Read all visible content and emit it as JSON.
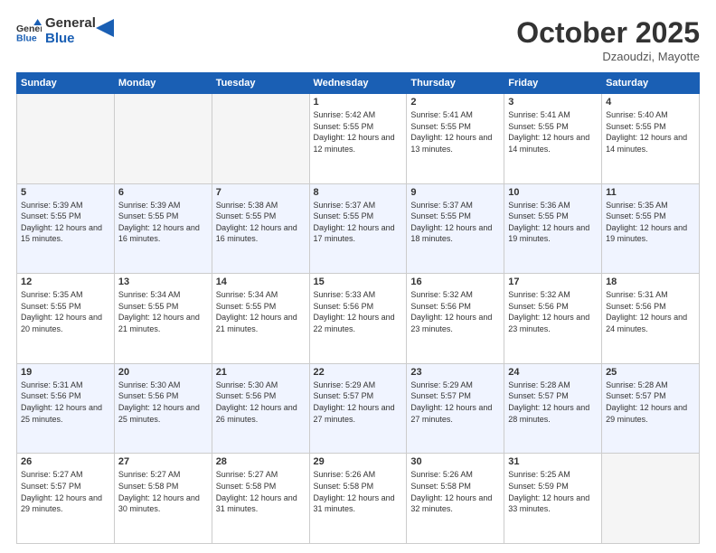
{
  "logo": {
    "line1": "General",
    "line2": "Blue"
  },
  "title": "October 2025",
  "subtitle": "Dzaoudzi, Mayotte",
  "weekdays": [
    "Sunday",
    "Monday",
    "Tuesday",
    "Wednesday",
    "Thursday",
    "Friday",
    "Saturday"
  ],
  "rows": [
    [
      {
        "day": "",
        "empty": true
      },
      {
        "day": "",
        "empty": true
      },
      {
        "day": "",
        "empty": true
      },
      {
        "day": "1",
        "sunrise": "5:42 AM",
        "sunset": "5:55 PM",
        "daylight": "12 hours and 12 minutes."
      },
      {
        "day": "2",
        "sunrise": "5:41 AM",
        "sunset": "5:55 PM",
        "daylight": "12 hours and 13 minutes."
      },
      {
        "day": "3",
        "sunrise": "5:41 AM",
        "sunset": "5:55 PM",
        "daylight": "12 hours and 14 minutes."
      },
      {
        "day": "4",
        "sunrise": "5:40 AM",
        "sunset": "5:55 PM",
        "daylight": "12 hours and 14 minutes."
      }
    ],
    [
      {
        "day": "5",
        "sunrise": "5:39 AM",
        "sunset": "5:55 PM",
        "daylight": "12 hours and 15 minutes."
      },
      {
        "day": "6",
        "sunrise": "5:39 AM",
        "sunset": "5:55 PM",
        "daylight": "12 hours and 16 minutes."
      },
      {
        "day": "7",
        "sunrise": "5:38 AM",
        "sunset": "5:55 PM",
        "daylight": "12 hours and 16 minutes."
      },
      {
        "day": "8",
        "sunrise": "5:37 AM",
        "sunset": "5:55 PM",
        "daylight": "12 hours and 17 minutes."
      },
      {
        "day": "9",
        "sunrise": "5:37 AM",
        "sunset": "5:55 PM",
        "daylight": "12 hours and 18 minutes."
      },
      {
        "day": "10",
        "sunrise": "5:36 AM",
        "sunset": "5:55 PM",
        "daylight": "12 hours and 19 minutes."
      },
      {
        "day": "11",
        "sunrise": "5:35 AM",
        "sunset": "5:55 PM",
        "daylight": "12 hours and 19 minutes."
      }
    ],
    [
      {
        "day": "12",
        "sunrise": "5:35 AM",
        "sunset": "5:55 PM",
        "daylight": "12 hours and 20 minutes."
      },
      {
        "day": "13",
        "sunrise": "5:34 AM",
        "sunset": "5:55 PM",
        "daylight": "12 hours and 21 minutes."
      },
      {
        "day": "14",
        "sunrise": "5:34 AM",
        "sunset": "5:55 PM",
        "daylight": "12 hours and 21 minutes."
      },
      {
        "day": "15",
        "sunrise": "5:33 AM",
        "sunset": "5:56 PM",
        "daylight": "12 hours and 22 minutes."
      },
      {
        "day": "16",
        "sunrise": "5:32 AM",
        "sunset": "5:56 PM",
        "daylight": "12 hours and 23 minutes."
      },
      {
        "day": "17",
        "sunrise": "5:32 AM",
        "sunset": "5:56 PM",
        "daylight": "12 hours and 23 minutes."
      },
      {
        "day": "18",
        "sunrise": "5:31 AM",
        "sunset": "5:56 PM",
        "daylight": "12 hours and 24 minutes."
      }
    ],
    [
      {
        "day": "19",
        "sunrise": "5:31 AM",
        "sunset": "5:56 PM",
        "daylight": "12 hours and 25 minutes."
      },
      {
        "day": "20",
        "sunrise": "5:30 AM",
        "sunset": "5:56 PM",
        "daylight": "12 hours and 25 minutes."
      },
      {
        "day": "21",
        "sunrise": "5:30 AM",
        "sunset": "5:56 PM",
        "daylight": "12 hours and 26 minutes."
      },
      {
        "day": "22",
        "sunrise": "5:29 AM",
        "sunset": "5:57 PM",
        "daylight": "12 hours and 27 minutes."
      },
      {
        "day": "23",
        "sunrise": "5:29 AM",
        "sunset": "5:57 PM",
        "daylight": "12 hours and 27 minutes."
      },
      {
        "day": "24",
        "sunrise": "5:28 AM",
        "sunset": "5:57 PM",
        "daylight": "12 hours and 28 minutes."
      },
      {
        "day": "25",
        "sunrise": "5:28 AM",
        "sunset": "5:57 PM",
        "daylight": "12 hours and 29 minutes."
      }
    ],
    [
      {
        "day": "26",
        "sunrise": "5:27 AM",
        "sunset": "5:57 PM",
        "daylight": "12 hours and 29 minutes."
      },
      {
        "day": "27",
        "sunrise": "5:27 AM",
        "sunset": "5:58 PM",
        "daylight": "12 hours and 30 minutes."
      },
      {
        "day": "28",
        "sunrise": "5:27 AM",
        "sunset": "5:58 PM",
        "daylight": "12 hours and 31 minutes."
      },
      {
        "day": "29",
        "sunrise": "5:26 AM",
        "sunset": "5:58 PM",
        "daylight": "12 hours and 31 minutes."
      },
      {
        "day": "30",
        "sunrise": "5:26 AM",
        "sunset": "5:58 PM",
        "daylight": "12 hours and 32 minutes."
      },
      {
        "day": "31",
        "sunrise": "5:25 AM",
        "sunset": "5:59 PM",
        "daylight": "12 hours and 33 minutes."
      },
      {
        "day": "",
        "empty": true
      }
    ]
  ]
}
